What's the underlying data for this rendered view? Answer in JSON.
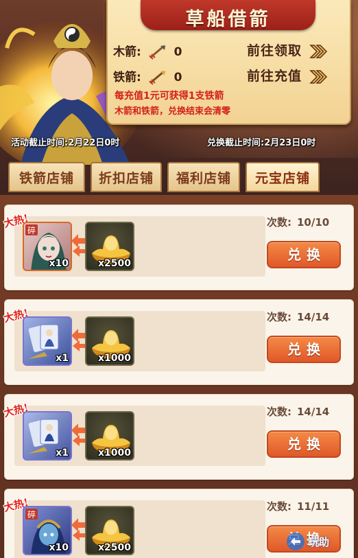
{
  "event": {
    "title": "草船借箭",
    "wood_arrow": {
      "label": "木箭:",
      "count": "0"
    },
    "iron_arrow": {
      "label": "铁箭:",
      "count": "0"
    },
    "goto_claim": "前往领取",
    "goto_recharge": "前往充值",
    "note_line1": "每充值1元可获得1支铁箭",
    "note_line2": "木箭和铁箭，兑换结束会清零",
    "activity_deadline": "活动截止时间:2月22日0时",
    "exchange_deadline": "兑换截止时间:2月23日0时"
  },
  "tabs": [
    {
      "label": "铁箭店铺",
      "active": false
    },
    {
      "label": "折扣店铺",
      "active": false
    },
    {
      "label": "福利店铺",
      "active": false
    },
    {
      "label": "元宝店铺",
      "active": true
    }
  ],
  "shop_items": [
    {
      "hot": "大热!",
      "item_qty": "x10",
      "item_icon": "hero-fragment-icon",
      "cost_qty": "x2500",
      "count_label": "次数:",
      "count": "10/10",
      "button": "兑换"
    },
    {
      "hot": "大热!",
      "item_qty": "x1",
      "item_icon": "hero-card-icon",
      "cost_qty": "x1000",
      "count_label": "次数:",
      "count": "14/14",
      "button": "兑换"
    },
    {
      "hot": "大热!",
      "item_qty": "x1",
      "item_icon": "hero-card-icon",
      "cost_qty": "x1000",
      "count_label": "次数:",
      "count": "14/14",
      "button": "兑换"
    },
    {
      "hot": "大热!",
      "item_qty": "x10",
      "item_icon": "hero-fragment-icon",
      "cost_qty": "x2500",
      "count_label": "次数:",
      "count": "11/11",
      "button": "兑换"
    }
  ],
  "watermark": "玩助",
  "colors": {
    "accent_red": "#d3201a",
    "button_orange": "#e0582a",
    "board": "#f6dca2"
  }
}
